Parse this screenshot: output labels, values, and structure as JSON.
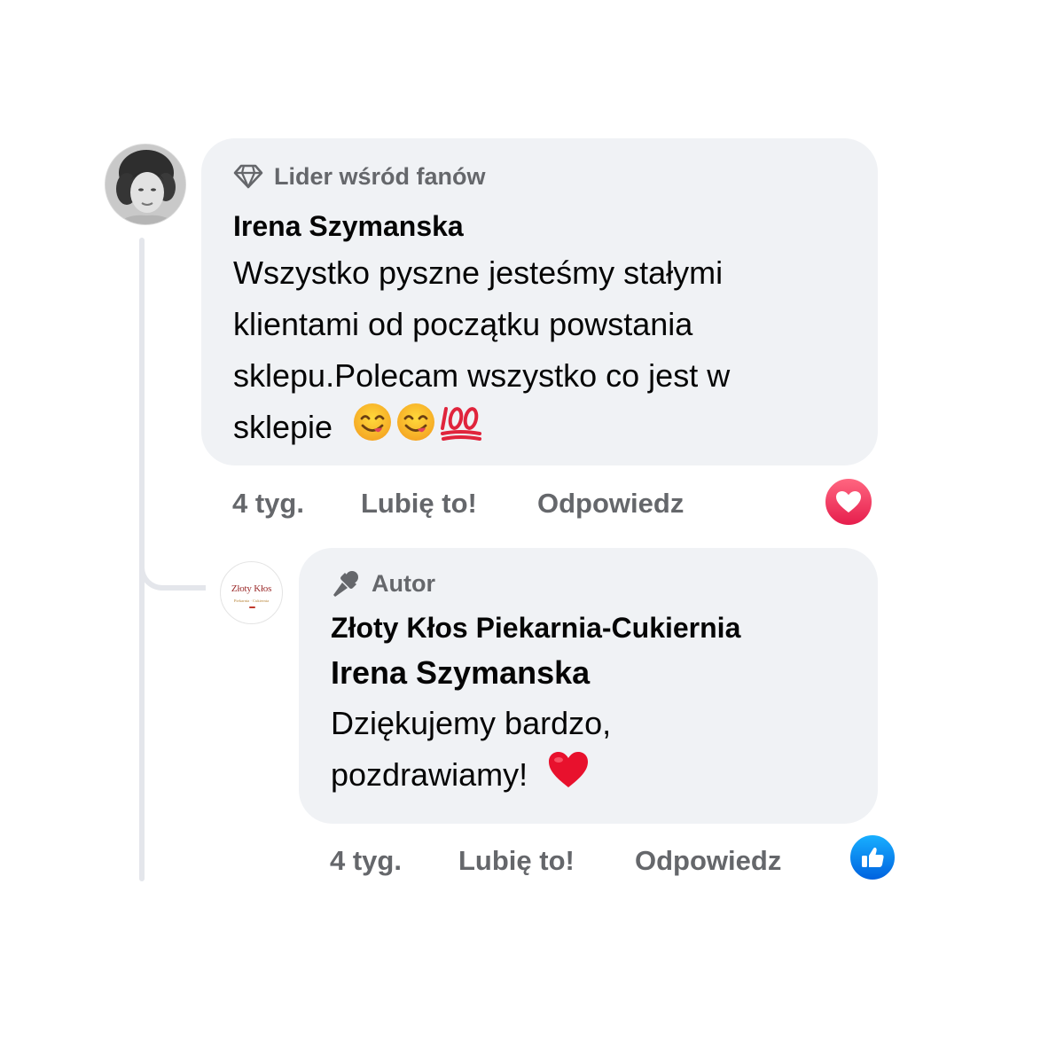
{
  "comment": {
    "badge": "Lider wśród fanów",
    "badge_icon": "diamond-icon",
    "author": "Irena Szymanska",
    "text_lines": [
      "Wszystko pyszne jesteśmy stałymi",
      "klientami od początku powstania",
      "sklepu.Polecam wszystko co jest w",
      "sklepie"
    ],
    "emojis": [
      "yum-emoji",
      "yum-emoji",
      "hundred-points-emoji"
    ],
    "time": "4 tyg.",
    "like_label": "Lubię to!",
    "reply_label": "Odpowiedz",
    "reaction_icon": "love-reaction-icon",
    "reaction_color": "#f33e58"
  },
  "reply": {
    "badge": "Autor",
    "badge_icon": "microphone-icon",
    "author": "Złoty Kłos Piekarnia-Cukiernia",
    "mention": "Irena Szymanska",
    "text_lines": [
      "Dziękujemy bardzo,",
      "pozdrawiamy!"
    ],
    "emojis": [
      "red-heart-emoji"
    ],
    "time": "4 tyg.",
    "like_label": "Lubię to!",
    "reply_label": "Odpowiedz",
    "reaction_icon": "like-reaction-icon",
    "reaction_color": "#0866ff",
    "avatar_logo_text": "Złoty Kłos",
    "avatar_logo_subtext": "Piekarnia · Cukiernia"
  }
}
